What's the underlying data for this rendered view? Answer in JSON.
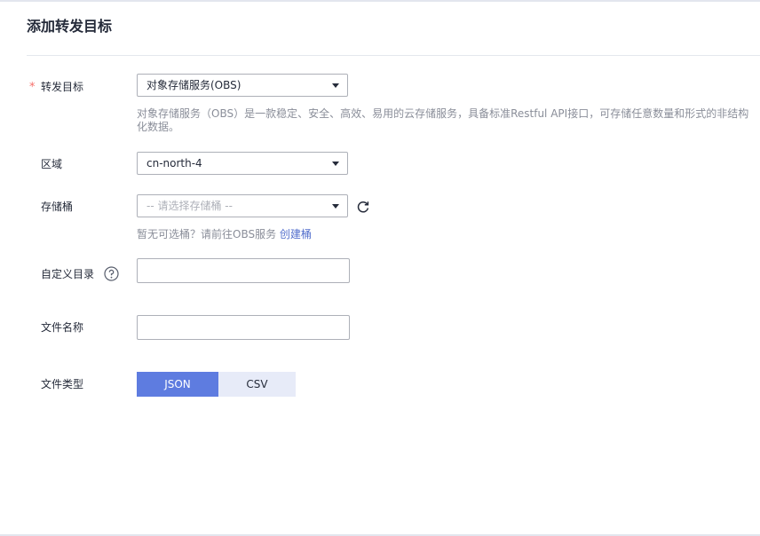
{
  "dialog": {
    "title": "添加转发目标"
  },
  "form": {
    "target": {
      "required_mark": "*",
      "label": "转发目标",
      "value": "对象存储服务(OBS)",
      "description": "对象存储服务（OBS）是一款稳定、安全、高效、易用的云存储服务，具备标准Restful API接口，可存储任意数量和形式的非结构化数据。"
    },
    "region": {
      "label": "区域",
      "value": "cn-north-4"
    },
    "bucket": {
      "label": "存储桶",
      "placeholder": "-- 请选择存储桶 --",
      "hint_text": "暂无可选桶？请前往OBS服务",
      "hint_link": "创建桶"
    },
    "custom_dir": {
      "label": "自定义目录",
      "value": ""
    },
    "file_name": {
      "label": "文件名称",
      "value": ""
    },
    "file_type": {
      "label": "文件类型",
      "options": [
        "JSON",
        "CSV"
      ],
      "selected": "JSON"
    }
  },
  "colors": {
    "primary": "#5e7ce0",
    "link": "#526ecc",
    "required": "#f66f6a",
    "segment_inactive": "#e7ebf8"
  }
}
